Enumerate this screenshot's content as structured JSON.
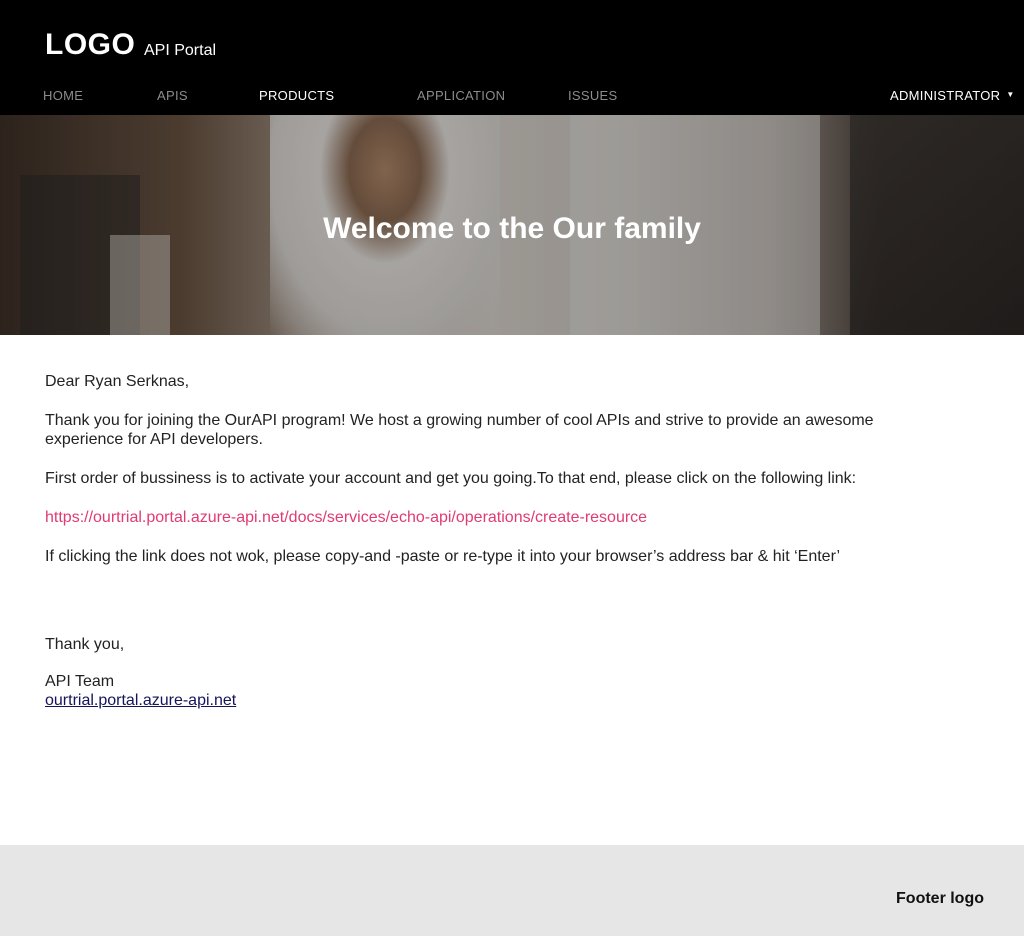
{
  "header": {
    "logo": "LOGO",
    "portal_name": "API Portal",
    "nav": {
      "home": "HOME",
      "apis": "APIS",
      "products": "PRODUCTS",
      "application": "APPLICATION",
      "issues": "ISSUES"
    },
    "user_menu": "ADMINISTRATOR",
    "user_menu_icon": "caret-down-icon"
  },
  "hero": {
    "title": "Welcome to the Our family"
  },
  "email": {
    "greeting": "Dear Ryan Serknas,",
    "intro": "Thank you for joining the OurAPI program! We host a growing number of cool APIs and strive to provide an awesome experience for API developers.",
    "instruction": "First order of bussiness is to activate your account and get you going.To that end, please click on the following link:",
    "activation_link": "https://ourtrial.portal.azure-api.net/docs/services/echo-api/operations/create-resource",
    "fallback": "If clicking the link does not wok, please copy-and -paste or re-type it into your browser’s address bar & hit ‘Enter’",
    "closing": "Thank you,",
    "signature": "API Team",
    "portal_link": "ourtrial.portal.azure-api.net"
  },
  "footer": {
    "logo": "Footer logo"
  },
  "colors": {
    "header_bg": "#000000",
    "link_pink": "#e03b72",
    "link_navy": "#14145a",
    "footer_bg": "#e6e6e6"
  }
}
